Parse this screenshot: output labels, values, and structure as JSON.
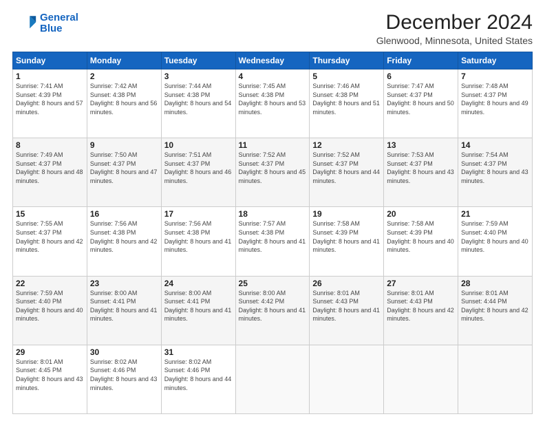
{
  "header": {
    "logo_line1": "General",
    "logo_line2": "Blue",
    "title": "December 2024",
    "subtitle": "Glenwood, Minnesota, United States"
  },
  "days_of_week": [
    "Sunday",
    "Monday",
    "Tuesday",
    "Wednesday",
    "Thursday",
    "Friday",
    "Saturday"
  ],
  "weeks": [
    [
      {
        "day": "1",
        "sunrise": "7:41 AM",
        "sunset": "4:39 PM",
        "daylight": "8 hours and 57 minutes."
      },
      {
        "day": "2",
        "sunrise": "7:42 AM",
        "sunset": "4:38 PM",
        "daylight": "8 hours and 56 minutes."
      },
      {
        "day": "3",
        "sunrise": "7:44 AM",
        "sunset": "4:38 PM",
        "daylight": "8 hours and 54 minutes."
      },
      {
        "day": "4",
        "sunrise": "7:45 AM",
        "sunset": "4:38 PM",
        "daylight": "8 hours and 53 minutes."
      },
      {
        "day": "5",
        "sunrise": "7:46 AM",
        "sunset": "4:38 PM",
        "daylight": "8 hours and 51 minutes."
      },
      {
        "day": "6",
        "sunrise": "7:47 AM",
        "sunset": "4:37 PM",
        "daylight": "8 hours and 50 minutes."
      },
      {
        "day": "7",
        "sunrise": "7:48 AM",
        "sunset": "4:37 PM",
        "daylight": "8 hours and 49 minutes."
      }
    ],
    [
      {
        "day": "8",
        "sunrise": "7:49 AM",
        "sunset": "4:37 PM",
        "daylight": "8 hours and 48 minutes."
      },
      {
        "day": "9",
        "sunrise": "7:50 AM",
        "sunset": "4:37 PM",
        "daylight": "8 hours and 47 minutes."
      },
      {
        "day": "10",
        "sunrise": "7:51 AM",
        "sunset": "4:37 PM",
        "daylight": "8 hours and 46 minutes."
      },
      {
        "day": "11",
        "sunrise": "7:52 AM",
        "sunset": "4:37 PM",
        "daylight": "8 hours and 45 minutes."
      },
      {
        "day": "12",
        "sunrise": "7:52 AM",
        "sunset": "4:37 PM",
        "daylight": "8 hours and 44 minutes."
      },
      {
        "day": "13",
        "sunrise": "7:53 AM",
        "sunset": "4:37 PM",
        "daylight": "8 hours and 43 minutes."
      },
      {
        "day": "14",
        "sunrise": "7:54 AM",
        "sunset": "4:37 PM",
        "daylight": "8 hours and 43 minutes."
      }
    ],
    [
      {
        "day": "15",
        "sunrise": "7:55 AM",
        "sunset": "4:37 PM",
        "daylight": "8 hours and 42 minutes."
      },
      {
        "day": "16",
        "sunrise": "7:56 AM",
        "sunset": "4:38 PM",
        "daylight": "8 hours and 42 minutes."
      },
      {
        "day": "17",
        "sunrise": "7:56 AM",
        "sunset": "4:38 PM",
        "daylight": "8 hours and 41 minutes."
      },
      {
        "day": "18",
        "sunrise": "7:57 AM",
        "sunset": "4:38 PM",
        "daylight": "8 hours and 41 minutes."
      },
      {
        "day": "19",
        "sunrise": "7:58 AM",
        "sunset": "4:39 PM",
        "daylight": "8 hours and 41 minutes."
      },
      {
        "day": "20",
        "sunrise": "7:58 AM",
        "sunset": "4:39 PM",
        "daylight": "8 hours and 40 minutes."
      },
      {
        "day": "21",
        "sunrise": "7:59 AM",
        "sunset": "4:40 PM",
        "daylight": "8 hours and 40 minutes."
      }
    ],
    [
      {
        "day": "22",
        "sunrise": "7:59 AM",
        "sunset": "4:40 PM",
        "daylight": "8 hours and 40 minutes."
      },
      {
        "day": "23",
        "sunrise": "8:00 AM",
        "sunset": "4:41 PM",
        "daylight": "8 hours and 41 minutes."
      },
      {
        "day": "24",
        "sunrise": "8:00 AM",
        "sunset": "4:41 PM",
        "daylight": "8 hours and 41 minutes."
      },
      {
        "day": "25",
        "sunrise": "8:00 AM",
        "sunset": "4:42 PM",
        "daylight": "8 hours and 41 minutes."
      },
      {
        "day": "26",
        "sunrise": "8:01 AM",
        "sunset": "4:43 PM",
        "daylight": "8 hours and 41 minutes."
      },
      {
        "day": "27",
        "sunrise": "8:01 AM",
        "sunset": "4:43 PM",
        "daylight": "8 hours and 42 minutes."
      },
      {
        "day": "28",
        "sunrise": "8:01 AM",
        "sunset": "4:44 PM",
        "daylight": "8 hours and 42 minutes."
      }
    ],
    [
      {
        "day": "29",
        "sunrise": "8:01 AM",
        "sunset": "4:45 PM",
        "daylight": "8 hours and 43 minutes."
      },
      {
        "day": "30",
        "sunrise": "8:02 AM",
        "sunset": "4:46 PM",
        "daylight": "8 hours and 43 minutes."
      },
      {
        "day": "31",
        "sunrise": "8:02 AM",
        "sunset": "4:46 PM",
        "daylight": "8 hours and 44 minutes."
      },
      null,
      null,
      null,
      null
    ]
  ]
}
